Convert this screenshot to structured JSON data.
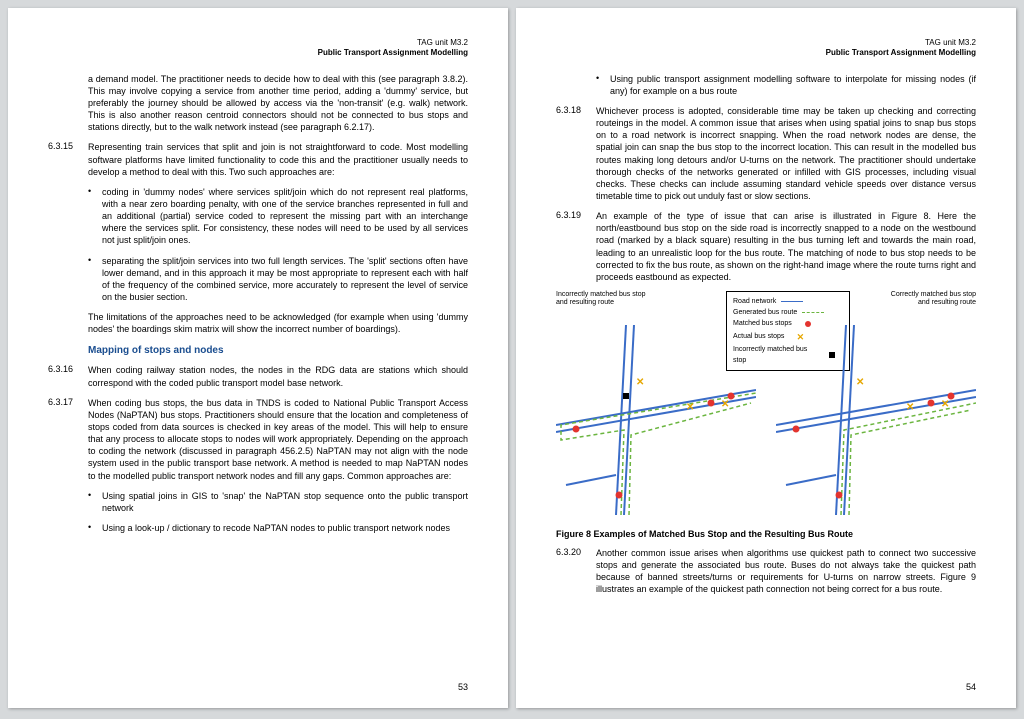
{
  "header": {
    "line1": "TAG unit M3.2",
    "line2": "Public Transport Assignment Modelling"
  },
  "page_left": {
    "intro": "a demand model. The practitioner needs to decide how to deal with this (see paragraph 3.8.2). This may involve copying a service from another time period, adding a 'dummy' service, but preferably the journey should be allowed by access via the 'non-transit' (e.g. walk) network. This is also another reason centroid connectors should not be connected to bus stops and stations directly, but to the walk network instead (see paragraph 6.2.17).",
    "p6315_num": "6.3.15",
    "p6315": "Representing train services that split and join is not straightforward to code. Most modelling software platforms have limited functionality to code this and the practitioner usually needs to develop a method to deal with this. Two such approaches are:",
    "b6315a": "coding in 'dummy nodes' where services split/join which do not represent real platforms, with a near zero boarding penalty, with one of the service branches represented in full and an additional (partial) service coded to represent the missing part with an interchange where the services split. For consistency, these nodes will need to be used by all services not just split/join ones.",
    "b6315b": "separating the split/join services into two full length services. The 'split' sections often have lower demand, and in this approach it may be most appropriate to represent each with half of the frequency of the combined service, more accurately to represent the level of service on the busier section.",
    "limitations": "The limitations of the approaches need to be acknowledged (for example when using 'dummy nodes' the boardings skim matrix will show the incorrect number of boardings).",
    "section": "Mapping of stops and nodes",
    "p6316_num": "6.3.16",
    "p6316": "When coding railway station nodes, the nodes in the RDG data are stations which should correspond with the coded public transport model base network.",
    "p6317_num": "6.3.17",
    "p6317": "When coding bus stops, the bus data in TNDS is coded to National Public Transport Access Nodes (NaPTAN) bus stops. Practitioners should ensure that the location and completeness of stops coded from data sources is checked in key areas of the model. This will help to ensure that any process to allocate stops to nodes will work appropriately. Depending on the approach to coding the network (discussed in paragraph 456.2.5) NaPTAN may not align with the node system used in the public transport base network. A method is needed to map NaPTAN nodes to the modelled public transport network nodes and fill any gaps. Common approaches are:",
    "b6317a": "Using spatial joins in GIS to 'snap' the NaPTAN stop sequence onto the public transport network",
    "b6317b": "Using a look-up / dictionary to recode NaPTAN nodes to public transport network nodes",
    "footer": "53"
  },
  "page_right": {
    "b6317c": "Using public transport assignment modelling software to interpolate for missing nodes (if any) for example on a bus route",
    "p6318_num": "6.3.18",
    "p6318": "Whichever process is adopted, considerable time may be taken up checking and correcting routeings in the model. A common issue that arises when using spatial joins to snap bus stops on to a road network is incorrect snapping. When the road network nodes are dense, the spatial join can snap the bus stop to the incorrect location. This can result in the modelled bus routes making long detours and/or U-turns on the network. The practitioner should undertake thorough checks of the networks generated or infilled with GIS processes, including visual checks. These checks can include assuming standard vehicle speeds over distance versus timetable time to pick out unduly fast or slow sections.",
    "p6319_num": "6.3.19",
    "p6319": "An example of the type of issue that can arise is illustrated in Figure 8. Here the north/eastbound bus stop on the side road is incorrectly snapped to a node on the westbound road (marked by a black square) resulting in the bus turning left and towards the main road, leading to an unrealistic loop for the bus route. The matching of node to bus stop needs to be corrected to fix the bus route, as shown on the right-hand image where the route turns right and proceeds eastbound as expected.",
    "fig_label_left": "Incorrectly matched bus stop and resulting route",
    "fig_label_right": "Correctly matched bus stop and resulting route",
    "legend": {
      "road": "Road network",
      "gen": "Generated bus route",
      "matched": "Matched bus stops",
      "actual": "Actual bus stops",
      "incorrect": "Incorrectly matched bus stop"
    },
    "figcaption": "Figure 8 Examples of Matched Bus Stop and the Resulting Bus Route",
    "p6320_num": "6.3.20",
    "p6320": "Another common issue arises when algorithms use quickest path to connect two successive stops and generate the associated bus route. Buses do not always take the quickest path because of banned streets/turns or requirements for U-turns on narrow streets. Figure 9 illustrates an example of the quickest path connection not being correct for a bus route.",
    "footer": "54"
  }
}
